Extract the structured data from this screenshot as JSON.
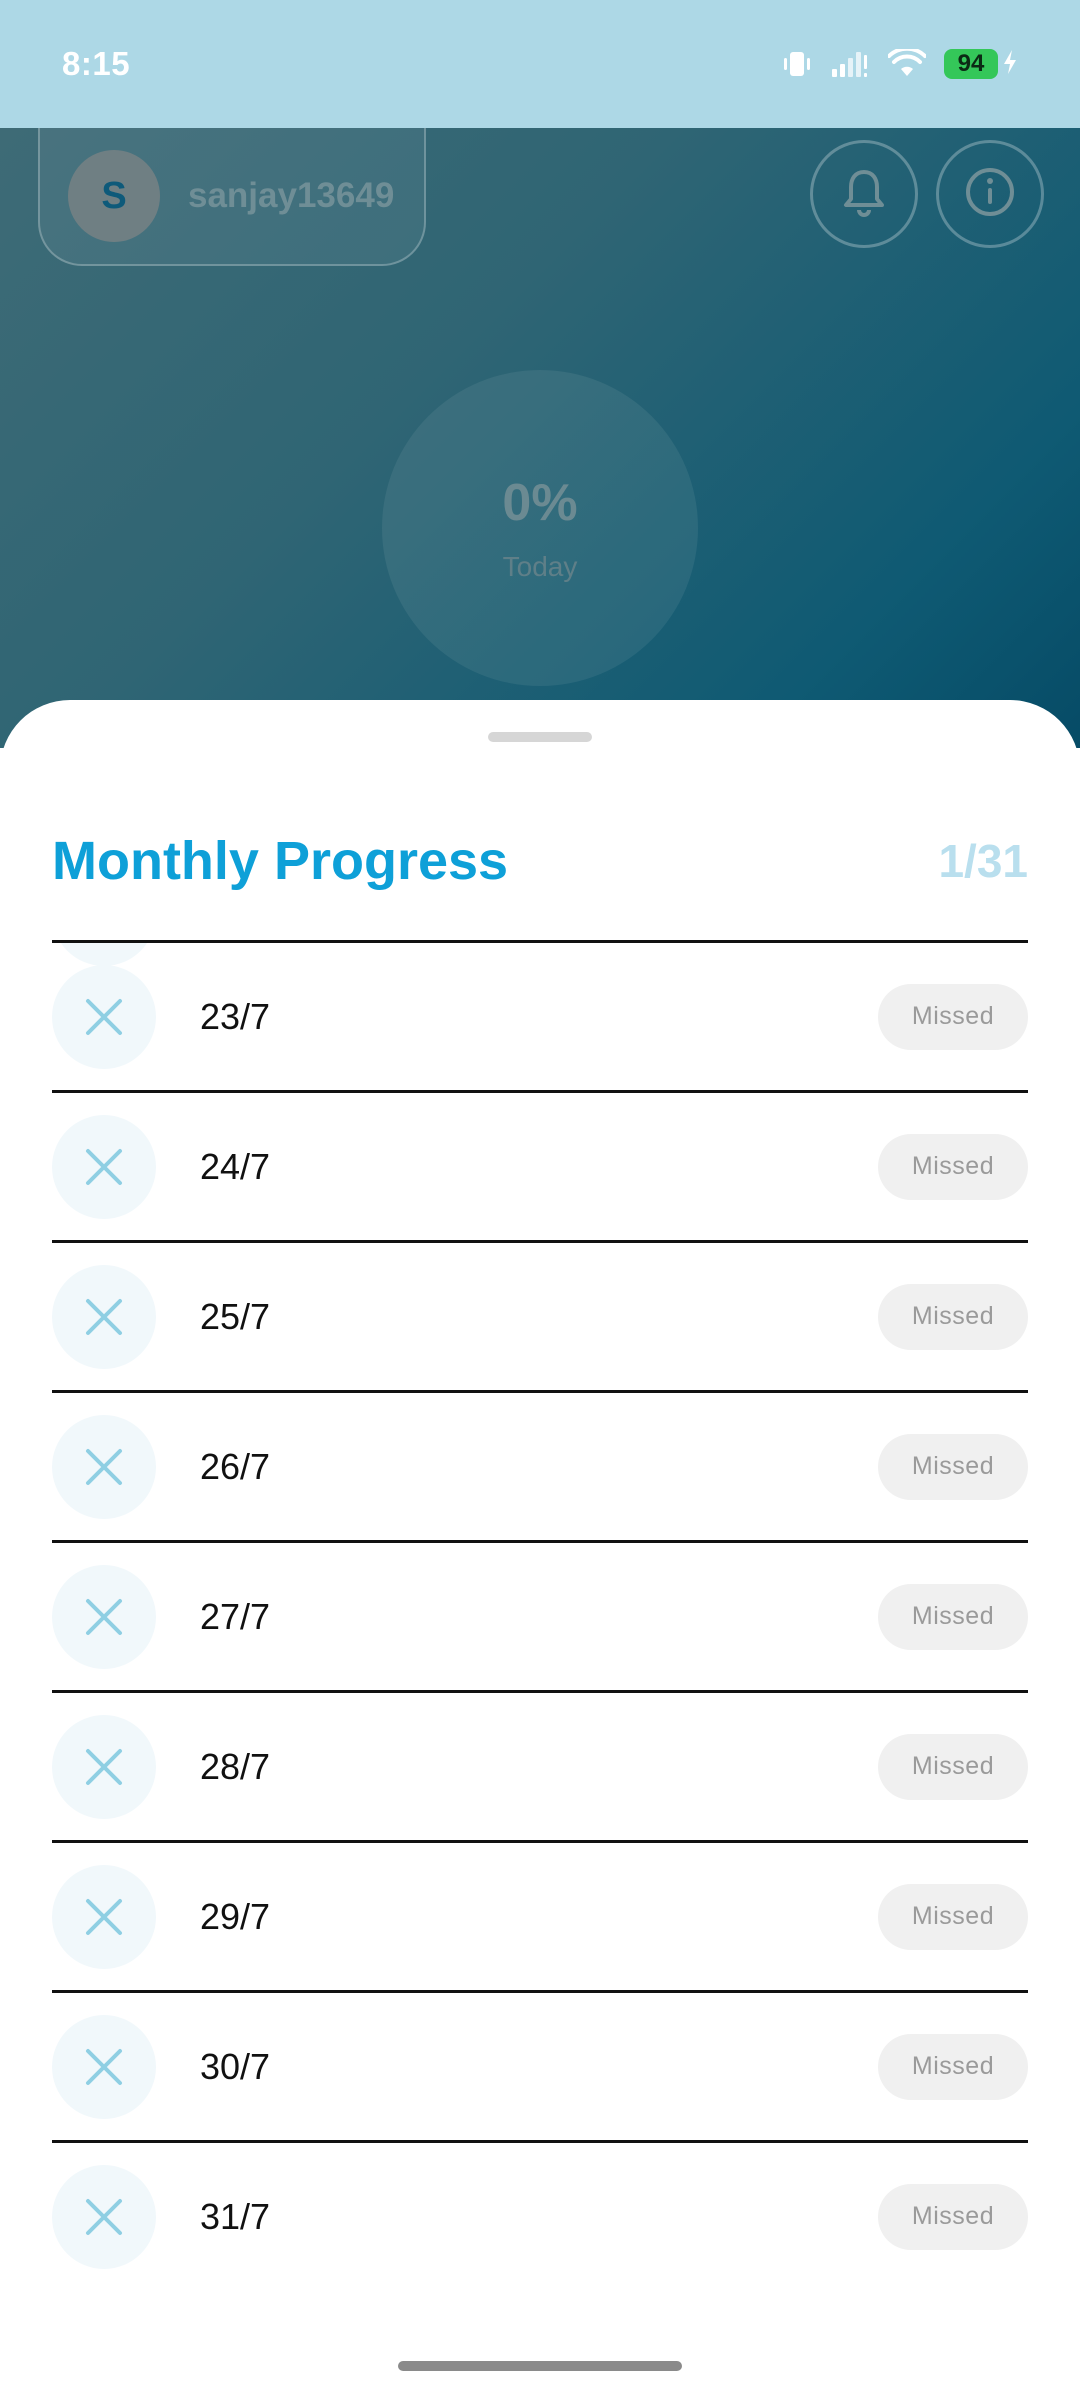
{
  "status_bar": {
    "time": "8:15",
    "battery_level": "94",
    "icons": [
      "vibrate-icon",
      "signal-icon",
      "wifi-icon",
      "battery-icon",
      "charging-icon"
    ]
  },
  "background": {
    "user": {
      "avatar_initial": "S",
      "username": "sanjay13649"
    },
    "buttons": [
      "bell-icon",
      "info-icon"
    ],
    "progress": {
      "value": "0%",
      "label": "Today"
    }
  },
  "sheet": {
    "title": "Monthly Progress",
    "count": "1/31",
    "rows": [
      {
        "date": "23/7",
        "status": "Missed"
      },
      {
        "date": "24/7",
        "status": "Missed"
      },
      {
        "date": "25/7",
        "status": "Missed"
      },
      {
        "date": "26/7",
        "status": "Missed"
      },
      {
        "date": "27/7",
        "status": "Missed"
      },
      {
        "date": "28/7",
        "status": "Missed"
      },
      {
        "date": "29/7",
        "status": "Missed"
      },
      {
        "date": "30/7",
        "status": "Missed"
      },
      {
        "date": "31/7",
        "status": "Missed"
      }
    ]
  },
  "colors": {
    "accent": "#0ea0d8",
    "status_bar": "#add8e6",
    "missed_x": "#8fcfe3"
  }
}
